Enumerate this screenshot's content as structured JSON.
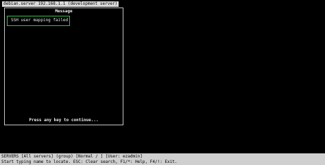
{
  "window": {
    "title": "debian.server 192.168.1.1 (development server)"
  },
  "dialog": {
    "title": "Message",
    "message": "SSH user mapping failed",
    "footer": "Press any key to continue..."
  },
  "status_bar": {
    "line1": "SERVERS [All servers] (group) [Normal / ] [User: ezadmin]",
    "line2": "Start typing name to locate. ESC: Clear search, F1/*: Help, F4/!: Exit."
  },
  "colors": {
    "background": "#000000",
    "highlight_border": "#39c44a",
    "status_bar_bg": "#cfcfcf"
  }
}
